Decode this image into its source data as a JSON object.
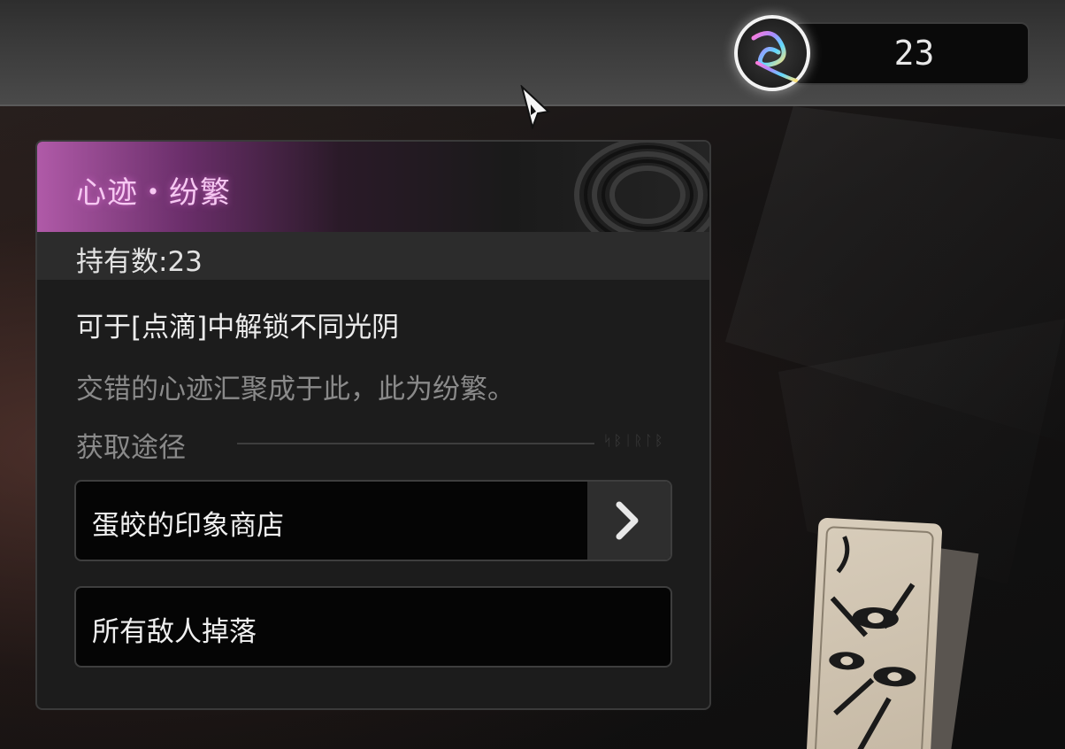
{
  "currency": {
    "icon": "feather-swirl-icon",
    "amount": "23"
  },
  "item_panel": {
    "title": "心迹・纷繁",
    "held_count": "持有数:23",
    "description": "可于[点滴]中解锁不同光阴",
    "flavor_text": "交错的心迹汇聚成于此，此为纷繁。",
    "source_heading": "获取途径",
    "source_glyphs": "ᛋᛒᛁᚱᛚᛒ",
    "sources": [
      {
        "label": "蛋皎的印象商店",
        "has_link": true,
        "link_icon": "chevron-right-icon"
      },
      {
        "label": "所有敌人掉落",
        "has_link": false
      }
    ]
  },
  "colors": {
    "title_glow": "#f6c8f2",
    "header_accent": "#b05aa8",
    "panel_bg": "#1c1c1c"
  }
}
